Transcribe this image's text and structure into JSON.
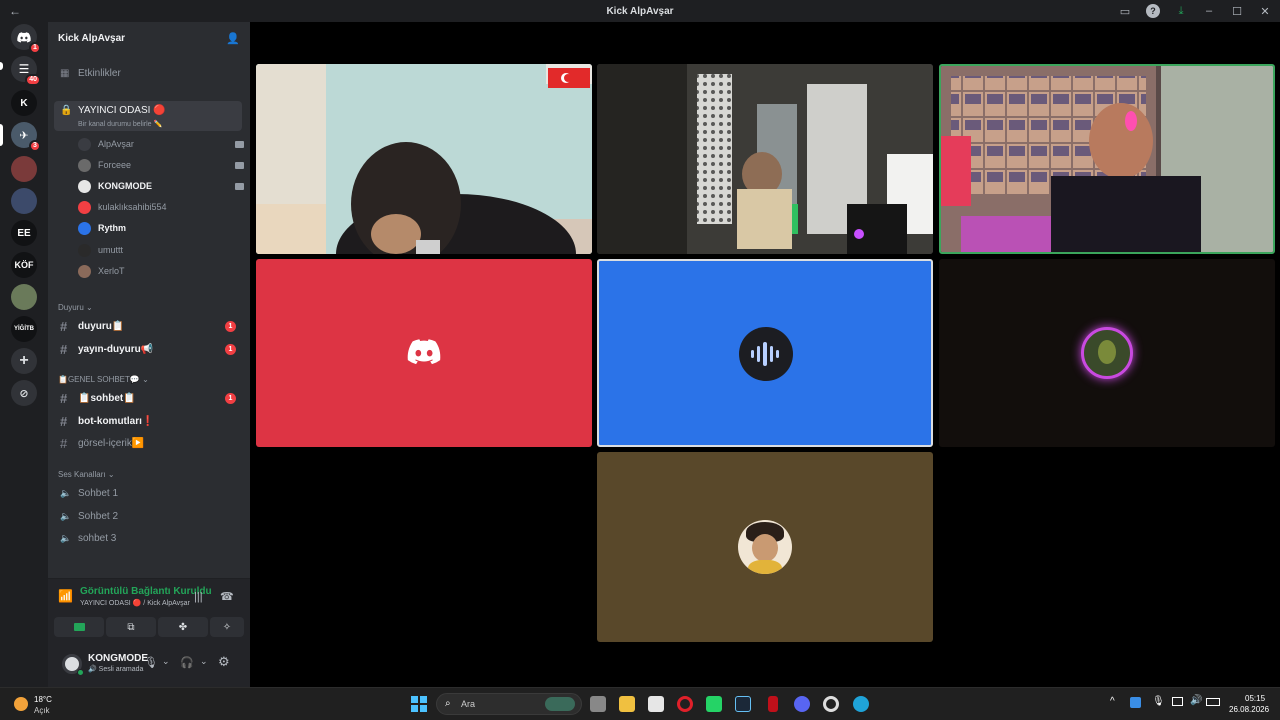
{
  "window": {
    "title": "Kick AlpAvşar"
  },
  "server_rail": {
    "items": [
      {
        "label": "",
        "badge": "1"
      },
      {
        "label": "",
        "badge": "40"
      },
      {
        "label": "K",
        "badge": ""
      },
      {
        "label": "",
        "badge": "3"
      },
      {
        "label": "",
        "badge": ""
      },
      {
        "label": "",
        "badge": ""
      },
      {
        "label": "EE",
        "badge": ""
      },
      {
        "label": "KÖF",
        "badge": ""
      },
      {
        "label": "",
        "badge": ""
      },
      {
        "label": "YİĞİTB",
        "badge": ""
      }
    ]
  },
  "sidebar": {
    "server_name": "Kick AlpAvşar",
    "events_label": "Etkinlikler",
    "active_voice_channel": {
      "name": "YAYINCI ODASI 🔴",
      "status_placeholder": "Bir kanal durumu belirle ✏️",
      "members": [
        {
          "name": "AlpAvşar",
          "camera": true,
          "bold": false
        },
        {
          "name": "Forceee",
          "camera": true,
          "bold": false
        },
        {
          "name": "KONGMODE",
          "camera": true,
          "bold": true
        },
        {
          "name": "kulaklıksahibi554",
          "camera": false,
          "bold": false
        },
        {
          "name": "Rythm",
          "camera": false,
          "bold": true
        },
        {
          "name": "umuttt",
          "camera": false,
          "bold": false
        },
        {
          "name": "XerloT",
          "camera": false,
          "bold": false
        }
      ]
    },
    "categories": [
      {
        "name": "Duyuru"
      },
      {
        "name": "📋GENEL SOHBET💬"
      },
      {
        "name": "Ses Kanalları"
      }
    ],
    "channels_duyuru": [
      {
        "name": "duyuru📋",
        "badge": "1",
        "unread": true
      },
      {
        "name": "yayın-duyuru📢",
        "badge": "1",
        "unread": true
      }
    ],
    "channels_genel": [
      {
        "name": "📋sohbet📋",
        "badge": "1",
        "unread": true
      },
      {
        "name": "bot-komutları❗",
        "badge": "",
        "unread": true
      },
      {
        "name": "görsel-içerik▶️",
        "badge": "",
        "unread": false
      }
    ],
    "voice_channels": [
      {
        "name": "Sohbet 1"
      },
      {
        "name": "Sohbet 2"
      },
      {
        "name": "sohbet 3"
      }
    ]
  },
  "voice_panel": {
    "status": "Görüntülü Bağlantı Kuruldu",
    "location": "YAYINCI ODASI 🔴 / Kick AlpAvşar"
  },
  "user_bar": {
    "username": "KONGMODE",
    "status": "🔊 Sesli aramada"
  },
  "taskbar": {
    "weather_temp": "18°C",
    "weather_desc": "Açık",
    "search_placeholder": "Ara",
    "time": "05:15",
    "date": "26.08.2026"
  },
  "colors": {
    "discord_tile": "#dd3444",
    "rythm_tile": "#2b73e8",
    "brown_tile": "#59482a",
    "speaking_ring": "#3ba55c",
    "selected_ring": "#dbdee1"
  }
}
